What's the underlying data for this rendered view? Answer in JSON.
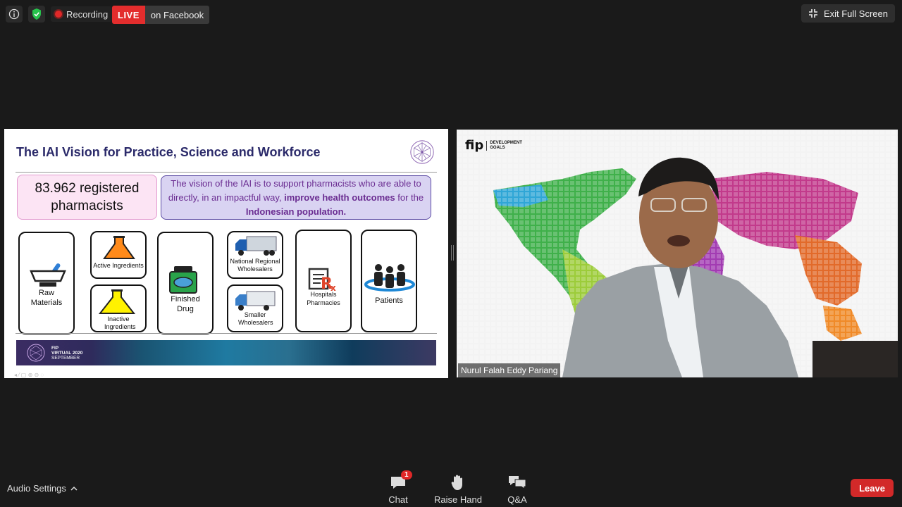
{
  "topbar": {
    "recording_label": "Recording",
    "live_tag": "LIVE",
    "live_platform": "on Facebook",
    "exit_fullscreen_label": "Exit Full Screen"
  },
  "slide": {
    "title": "The IAI Vision for Practice, Science and Workforce",
    "stat_line1": "83.962 registered",
    "stat_line2": "pharmacists",
    "vision_part1": "The vision of the IAI is to support pharmacists who are able to directly, in an impactful way, ",
    "vision_bold1": "improve health outcomes",
    "vision_part2": " for the ",
    "vision_bold2": "Indonesian population.",
    "chain": {
      "raw_materials": "Raw Materials",
      "active_ingredients": "Active Ingredients",
      "inactive_ingredients": "Inactive Ingredients",
      "finished_drug": "Finished Drug",
      "national_wholesalers": "National Regional Wholesalers",
      "smaller_wholesalers": "Smaller Wholesalers",
      "hospitals_pharmacies": "Hospitals Pharmacies",
      "patients": "Patients"
    },
    "banner_line1": "FIP",
    "banner_line2": "VIRTUAL 2020",
    "banner_line3": "SEPTEMBER"
  },
  "video": {
    "logo_fip": "fip",
    "logo_line1": "DEVELOPMENT",
    "logo_line2": "GOALS",
    "speaker_name": "Nurul Falah Eddy Pariang"
  },
  "bottombar": {
    "audio_settings_label": "Audio Settings",
    "chat_label": "Chat",
    "chat_badge": "1",
    "raise_hand_label": "Raise Hand",
    "qa_label": "Q&A",
    "leave_label": "Leave"
  },
  "colors": {
    "live_red": "#e32d2d",
    "leave_red": "#d22929",
    "slide_title": "#2b2a6a",
    "vision_text": "#6a2c91",
    "shield_green": "#27c24c"
  },
  "icons": [
    "info-icon",
    "shield-check-icon",
    "recording-dot-icon",
    "exit-fullscreen-icon",
    "chevron-up-icon",
    "chat-icon",
    "raise-hand-icon",
    "qa-icon"
  ]
}
